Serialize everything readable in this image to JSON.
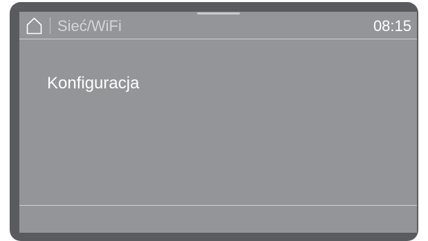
{
  "header": {
    "title": "Sieć/WiFi",
    "time": "08:15"
  },
  "menu": {
    "items": [
      {
        "label": "Konfiguracja"
      }
    ]
  },
  "colors": {
    "bezel": "#5a5b5e",
    "screen": "#939598",
    "text": "#ffffff"
  },
  "icons": {
    "home": "home-icon"
  }
}
